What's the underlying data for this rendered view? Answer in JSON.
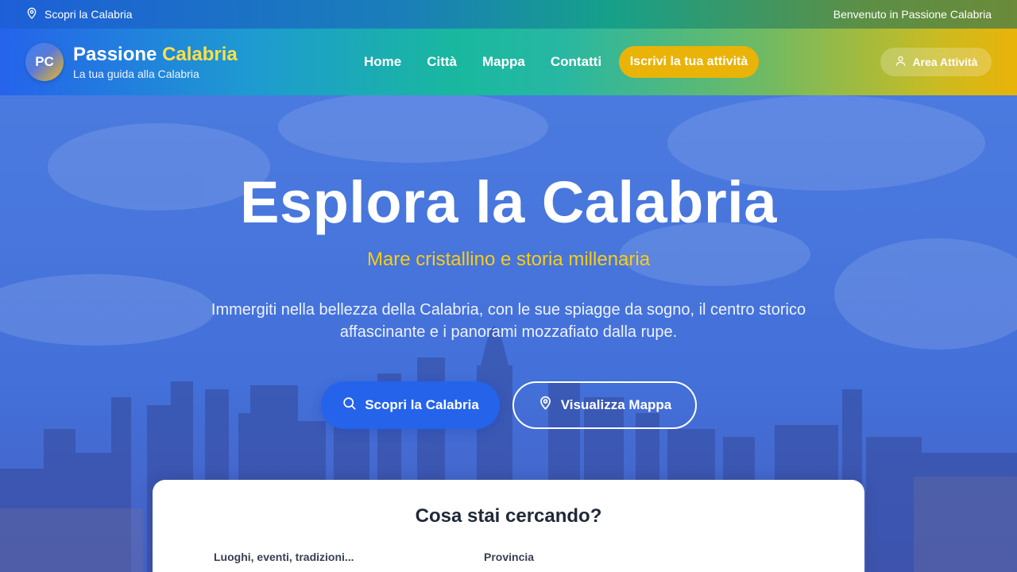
{
  "colors": {
    "primary": "#2563eb",
    "accent": "#eab308",
    "tagline": "#facc15"
  },
  "topbar": {
    "location_icon": "map-pin-icon",
    "left_text": "Scopri la Calabria",
    "right_text": "Benvenuto in Passione Calabria"
  },
  "header": {
    "logo_initials": "PC",
    "brand_part1": "Passione",
    "brand_part2": "Calabria",
    "brand_subtitle": "La tua guida alla Calabria",
    "nav": {
      "home": "Home",
      "citta": "Città",
      "mappa": "Mappa",
      "contatti": "Contatti"
    },
    "cta_label": "Iscrivi la tua attività",
    "area_icon": "user-icon",
    "area_label": "Area Attività"
  },
  "hero": {
    "title": "Esplora la Calabria",
    "tagline": "Mare cristallino e storia millenaria",
    "description": "Immergiti nella bellezza della Calabria, con le sue spiagge da sogno, il centro storico affascinante e i panorami mozzafiato dalla rupe.",
    "primary_button": "Scopri la Calabria",
    "primary_icon": "search-icon",
    "secondary_button": "Visualizza Mappa",
    "secondary_icon": "map-pin-icon"
  },
  "search": {
    "title": "Cosa stai cercando?",
    "query_label": "Luoghi, eventi, tradizioni...",
    "province_label": "Provincia"
  }
}
